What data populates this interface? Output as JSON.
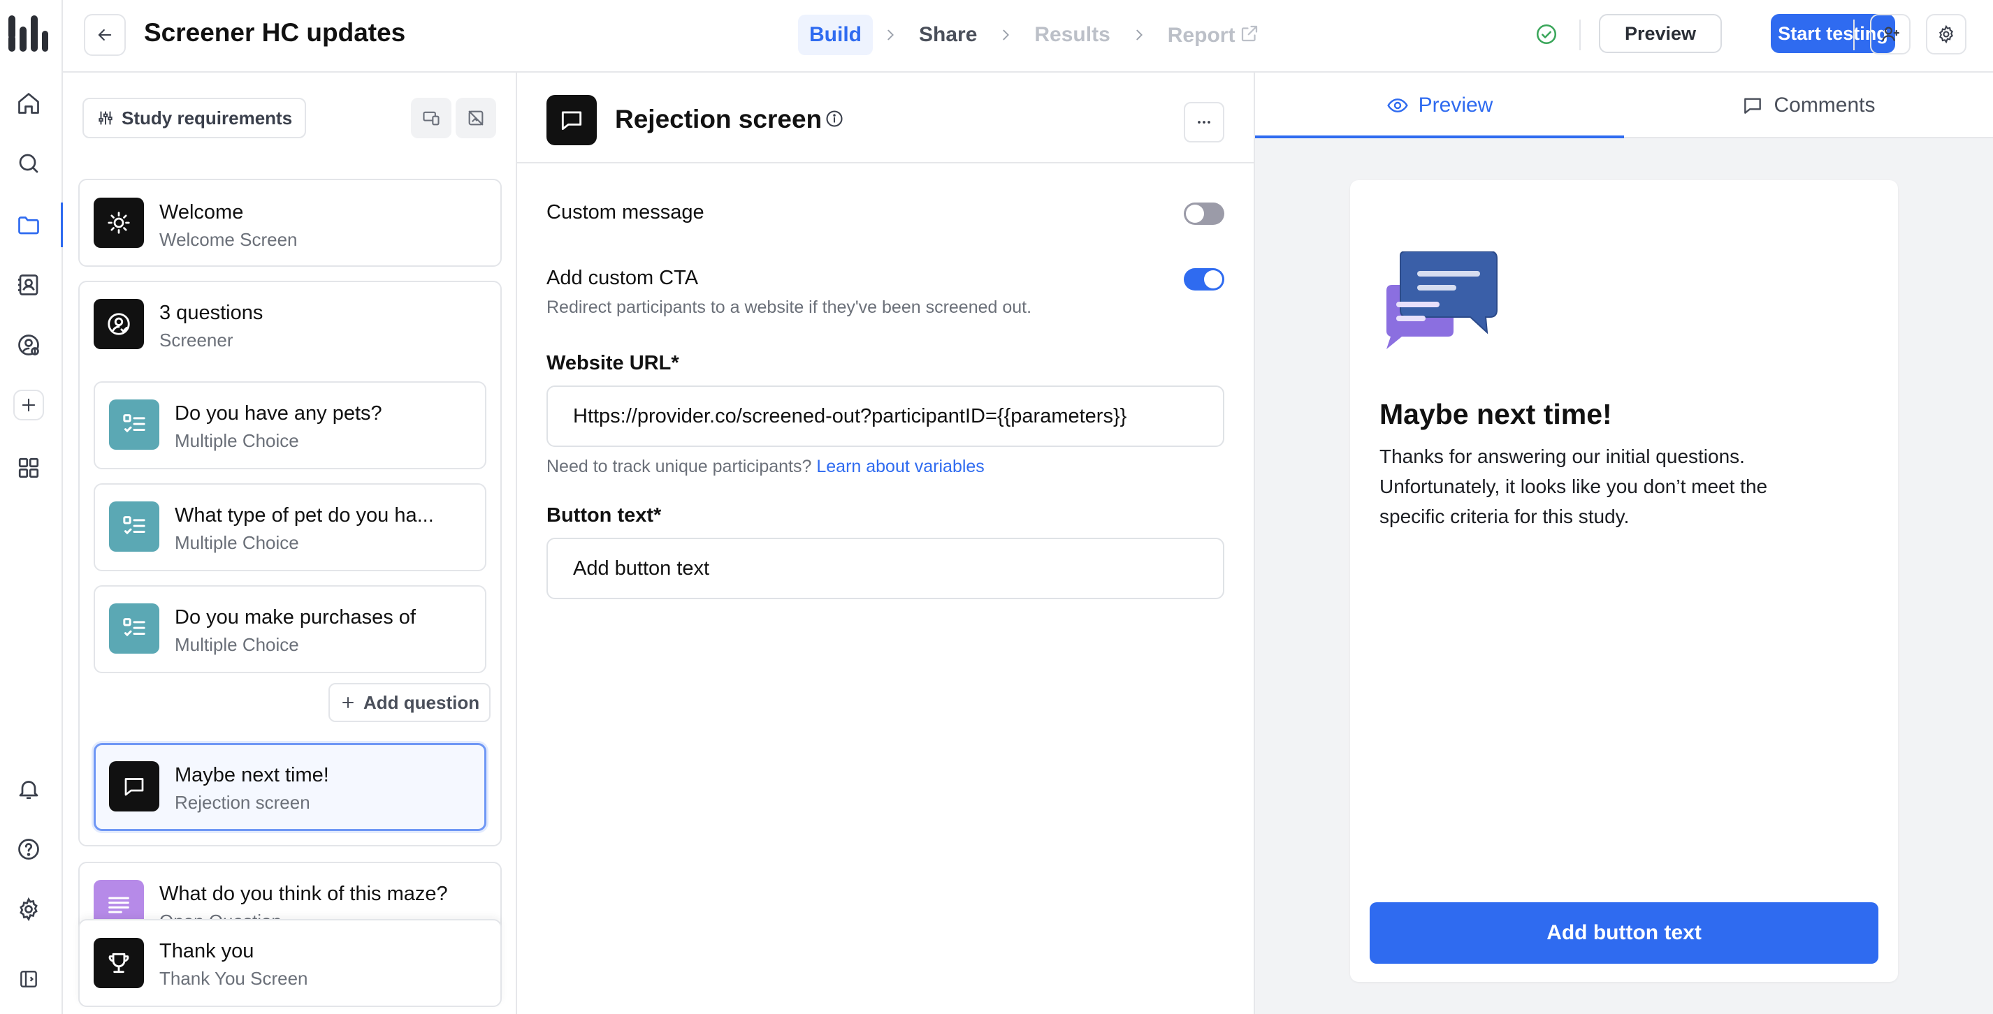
{
  "app": {
    "title": "Screener HC updates",
    "accent_color": "#2f6bf0"
  },
  "nav_rail": {
    "items": [
      "home-icon",
      "search-icon",
      "folder-icon",
      "contacts-icon",
      "user-settings-icon",
      "plus-icon",
      "apps-grid-icon",
      "bell-icon",
      "help-icon",
      "gear-icon",
      "sidebar-collapse-icon"
    ],
    "active": "folder-icon"
  },
  "header": {
    "steps": [
      {
        "label": "Build",
        "state": "active"
      },
      {
        "label": "Share",
        "state": "done"
      },
      {
        "label": "Results",
        "state": "disabled"
      },
      {
        "label": "Report",
        "state": "disabled"
      }
    ],
    "status_icon": "check-circle-icon",
    "preview_label": "Preview",
    "start_label": "Start testing"
  },
  "structure": {
    "requirements_label": "Study requirements",
    "welcome": {
      "title": "Welcome",
      "subtitle": "Welcome Screen"
    },
    "screener": {
      "title": "3 questions",
      "subtitle": "Screener",
      "questions": [
        {
          "title": "Do you have any pets?",
          "type": "Multiple Choice"
        },
        {
          "title": "What type of pet do you ha...",
          "type": "Multiple Choice"
        },
        {
          "title": "Do you make purchases of",
          "type": "Multiple Choice"
        }
      ],
      "add_question_label": "Add question",
      "rejection": {
        "title": "Maybe next time!",
        "subtitle": "Rejection screen"
      }
    },
    "open_question": {
      "title": "What do you think of this maze?",
      "subtitle": "Open Question"
    },
    "thank_you": {
      "title": "Thank you",
      "subtitle": "Thank You Screen"
    }
  },
  "editor": {
    "title": "Rejection screen",
    "custom_message": {
      "label": "Custom message",
      "enabled": false
    },
    "custom_cta": {
      "label": "Add custom CTA",
      "description": "Redirect participants to a website if they've been screened out.",
      "enabled": true
    },
    "website_url": {
      "label": "Website URL*",
      "value": "Https://provider.co/screened-out?participantID={{parameters}}",
      "help_text": "Need to track unique participants?",
      "help_link": "Learn about variables"
    },
    "button_text": {
      "label": "Button text*",
      "placeholder": "Add button text"
    }
  },
  "preview_panel": {
    "tabs": [
      {
        "label": "Preview",
        "active": true
      },
      {
        "label": "Comments",
        "active": false
      }
    ],
    "heading": "Maybe next time!",
    "body": "Thanks for answering our initial questions. Unfortunately, it looks like you don’t meet the specific criteria for this study.",
    "button_label": "Add button text"
  }
}
